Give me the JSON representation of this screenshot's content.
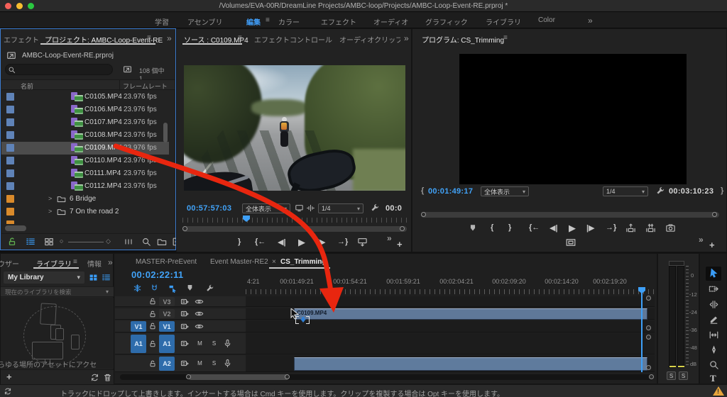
{
  "colors": {
    "accent_blue": "#3a9bf4",
    "timecode_blue": "#41a2f7",
    "clip_blue": "#5f7899",
    "folder_orange": "#d98a2b",
    "label_blue": "#5f83b8",
    "arrow_red": "#e8260f",
    "warning_yellow": "#e7a53c"
  },
  "icons": {
    "menu": "≡",
    "overflow": "»",
    "chevron_down": "▾",
    "close": "×",
    "plus": "+",
    "expand": ">",
    "play": "▶",
    "step_back": "◀|",
    "step_forward": "|▶",
    "goto_in": "{←",
    "goto_out": "→}",
    "mark_in": "{",
    "mark_out": "}",
    "slider_knob": "○",
    "slider_max": "◇",
    "warning": "!"
  },
  "titlebar": {
    "title": "/Volumes/EVA-00R/DreamLine Projects/AMBC-loop/Projects/AMBC-Loop-Event-RE.prproj *"
  },
  "workspace": {
    "tabs": [
      "学習",
      "アセンブリ",
      "編集",
      "カラー",
      "エフェクト",
      "オーディオ",
      "グラフィック",
      "ライブラリ",
      "Color"
    ],
    "active": "編集"
  },
  "project_panel": {
    "tab_effects": "エフェクト",
    "tab_project": "プロジェクト: AMBC-Loop-Event-RE",
    "breadcrumb": "AMBC-Loop-Event-RE.prproj",
    "result_count": "108 個中 1…",
    "columns": {
      "name": "名前",
      "framerate": "フレームレート"
    },
    "clips": [
      {
        "name": "C0105.MP4",
        "fps": "23.976 fps"
      },
      {
        "name": "C0106.MP4",
        "fps": "23.976 fps"
      },
      {
        "name": "C0107.MP4",
        "fps": "23.976 fps"
      },
      {
        "name": "C0108.MP4",
        "fps": "23.976 fps"
      },
      {
        "name": "C0109.MP4",
        "fps": "23.976 fps"
      },
      {
        "name": "C0110.MP4",
        "fps": "23.976 fps"
      },
      {
        "name": "C0111.MP4",
        "fps": "23.976 fps"
      },
      {
        "name": "C0112.MP4",
        "fps": "23.976 fps"
      }
    ],
    "selected_clip": "C0109.MP4",
    "folders": [
      {
        "name": "6 Bridge"
      },
      {
        "name": "7 On the road 2"
      }
    ]
  },
  "source_monitor": {
    "tab_source": "ソース : C0109.MP4",
    "tab_effect_controls": "エフェクトコントロール",
    "tab_audio_clip": "オーディオクリップ",
    "timecode": "00:57:57:03",
    "fit": "全体表示",
    "playback_resolution": "1/4",
    "duration": "00:0"
  },
  "program_monitor": {
    "tab": "プログラム: CS_Trimming",
    "in_timecode": "00:01:49:17",
    "fit": "全体表示",
    "playback_resolution": "1/4",
    "out_timecode": "00:03:10:23"
  },
  "timeline": {
    "tabs": [
      "MASTER-PreEvent",
      "Event Master-RE2",
      "CS_Trimming"
    ],
    "active_tab": "CS_Trimming",
    "timecode": "00:02:22:11",
    "ruler_labels": [
      "4:21",
      "00:01:49:21",
      "00:01:54:21",
      "00:01:59:21",
      "00:02:04:21",
      "00:02:09:20",
      "00:02:14:20",
      "00:02:19:20"
    ],
    "tracks": {
      "v3": "V3",
      "v2": "V2",
      "v1": "V1",
      "a1": "A1",
      "a2": "A2"
    },
    "source_patches": {
      "video": "V1",
      "audio": "A1"
    },
    "clip_name": "C0109.MP4",
    "audio_buttons": {
      "mute": "M",
      "solo": "S"
    }
  },
  "audio_meter": {
    "scale": [
      "0",
      "-12",
      "-24",
      "-36",
      "-48",
      "dB"
    ],
    "solo": "S"
  },
  "library_panel": {
    "tab_browser": "ウザー",
    "tab_library": "ライブラリ",
    "tab_info": "情報",
    "collection": "My Library",
    "search_placeholder": "現在のライブラリを検索",
    "teaser": "らゆる場所のアセットにアクセ"
  },
  "status_bar": {
    "message": "トラックにドロップして上書きします。インサートする場合は Cmd キーを使用します。クリップを複製する場合は Opt キーを使用します。"
  }
}
